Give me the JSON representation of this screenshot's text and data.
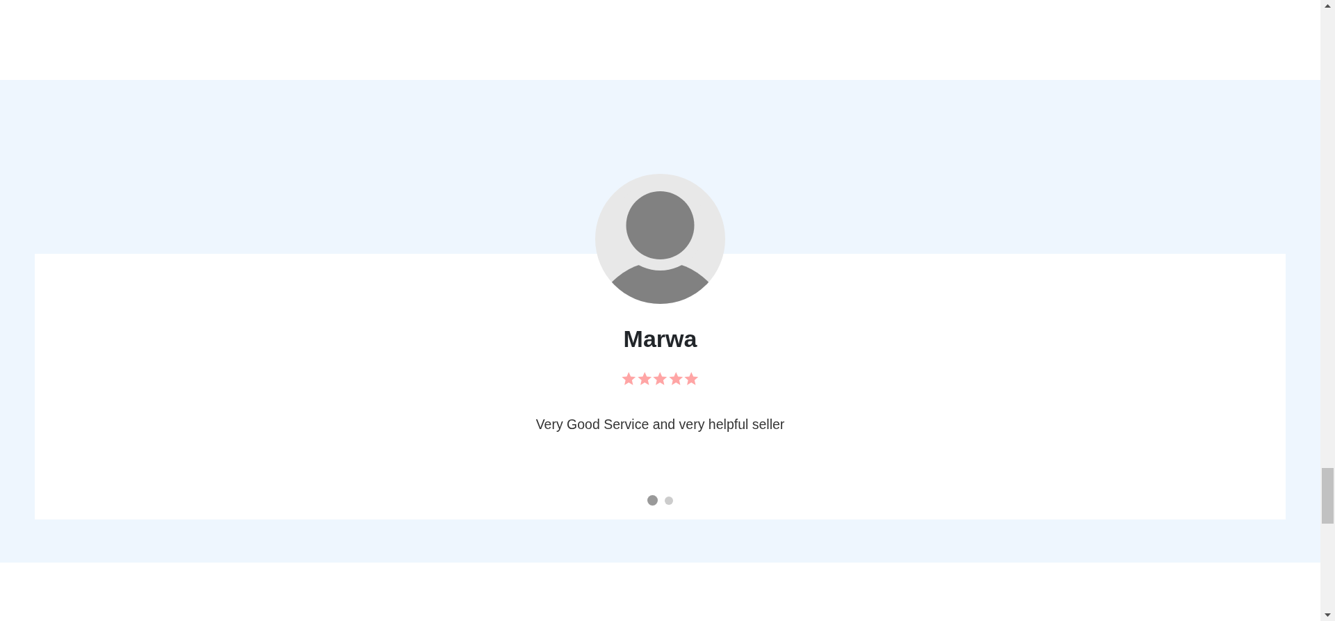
{
  "testimonial": {
    "name": "Marwa",
    "stars": 5,
    "text": "Very Good Service and very helpful seller"
  },
  "carousel_dots": [
    {
      "selected": true
    },
    {
      "selected": false
    }
  ]
}
